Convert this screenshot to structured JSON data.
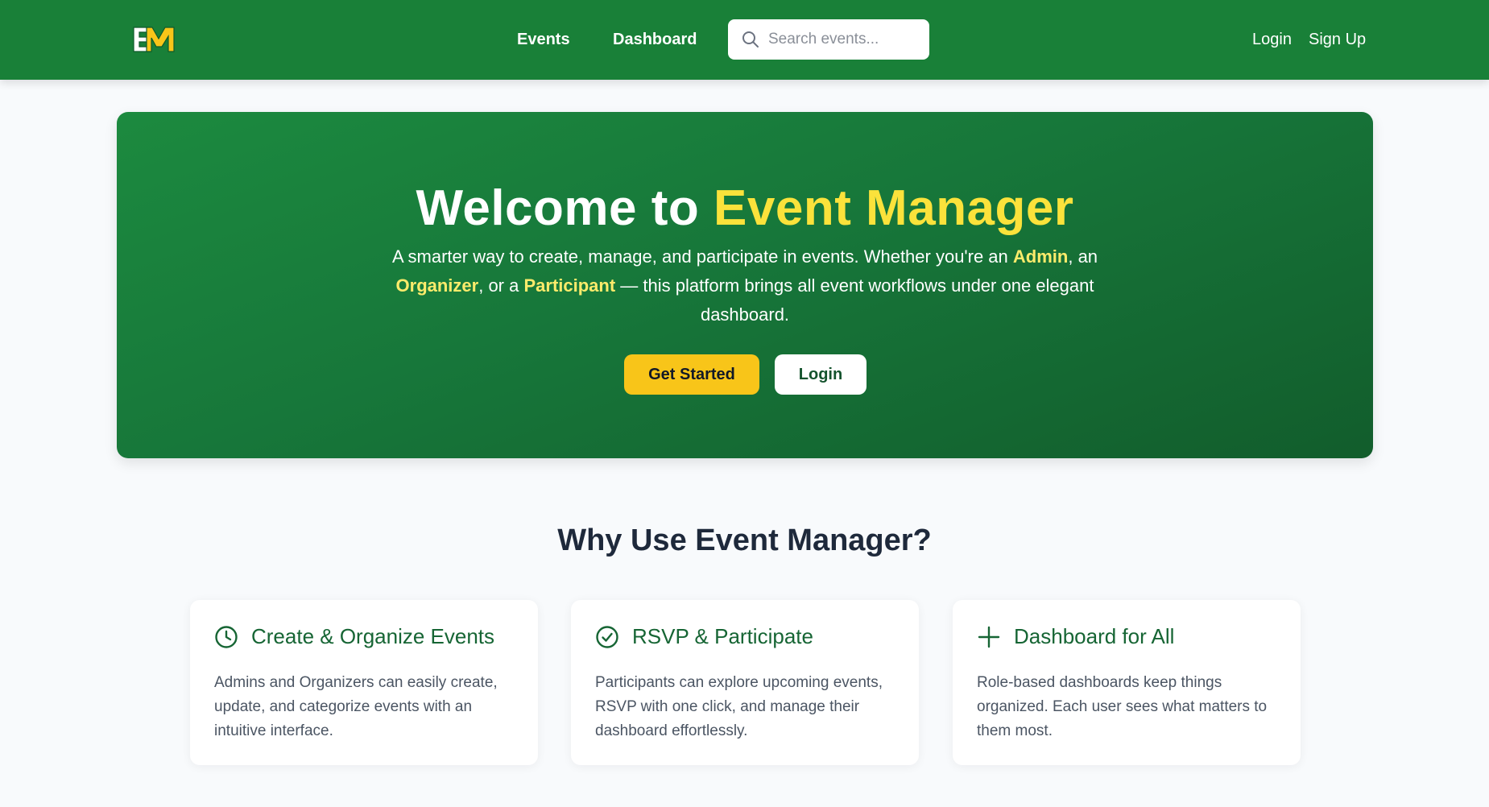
{
  "header": {
    "logo_text": "EM",
    "nav": {
      "events": "Events",
      "dashboard": "Dashboard"
    },
    "search": {
      "placeholder": "Search events..."
    },
    "auth": {
      "login": "Login",
      "signup": "Sign Up"
    }
  },
  "hero": {
    "title_prefix": "Welcome to",
    "title_accent": "Event Manager",
    "description": {
      "part1": "A smarter way to create, manage, and participate in events. Whether you're an ",
      "role1": "Admin",
      "part2": ", an ",
      "role2": "Organizer",
      "part3": ", or a ",
      "role3": "Participant",
      "part4": " — this platform brings all event workflows under one elegant dashboard."
    },
    "primary_button": "Get Started",
    "secondary_button": "Login"
  },
  "features": {
    "title": "Why Use Event Manager?",
    "cards": [
      {
        "icon": "clock-icon",
        "title": "Create & Organize Events",
        "text": "Admins and Organizers can easily create, update, and categorize events with an intuitive interface."
      },
      {
        "icon": "check-circle-icon",
        "title": "RSVP & Participate",
        "text": "Participants can explore upcoming events, RSVP with one click, and manage their dashboard effortlessly."
      },
      {
        "icon": "plus-icon",
        "title": "Dashboard for All",
        "text": "Role-based dashboards keep things organized. Each user sees what matters to them most."
      }
    ]
  },
  "colors": {
    "brand_green": "#198038",
    "accent_yellow": "#fbe23b",
    "button_yellow": "#f8c519",
    "card_title_green": "#166534"
  }
}
